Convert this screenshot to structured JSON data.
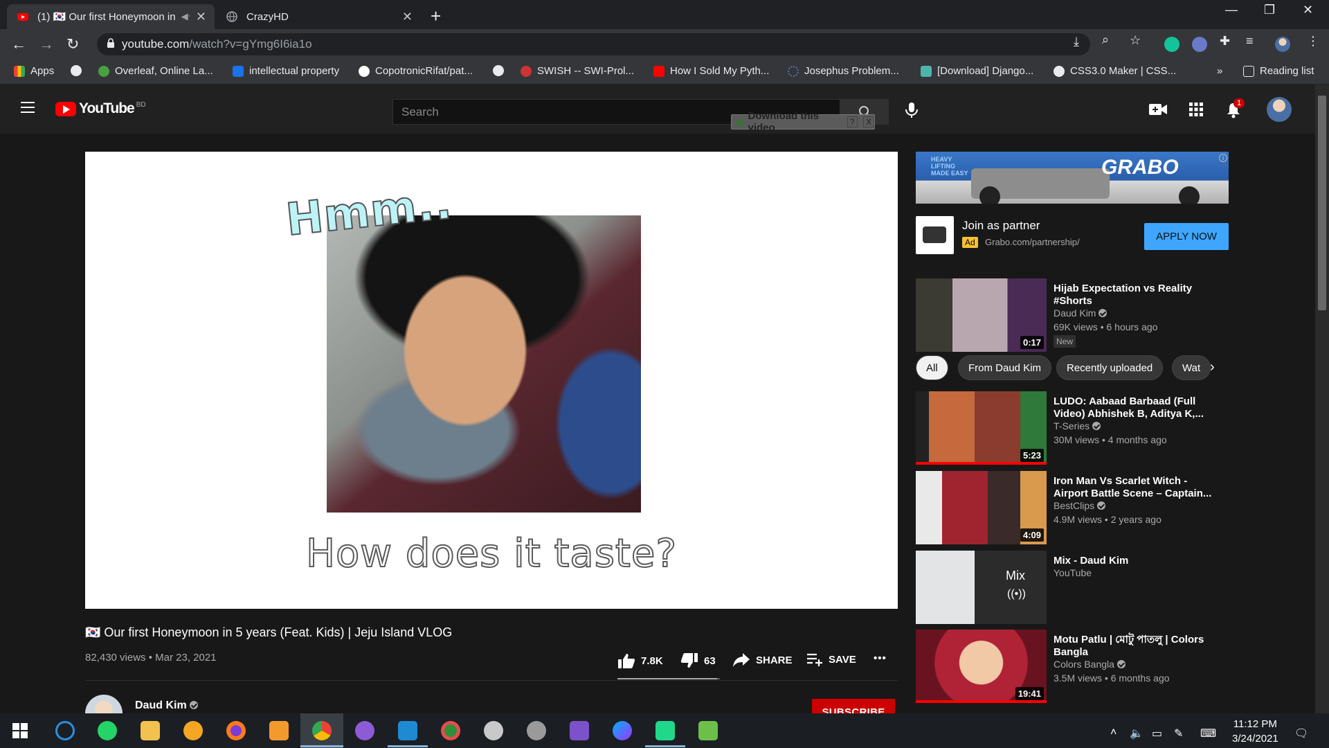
{
  "browser": {
    "tabs": [
      {
        "title": "(1) 🇰🇷 Our first Honeymoon in",
        "close": "✕"
      },
      {
        "title": "CrazyHD",
        "close": "✕"
      }
    ],
    "new_tab": "+",
    "url_host": "youtube.com",
    "url_path": "/watch?v=gYmg6I6ia1o",
    "bookmarks": [
      {
        "label": "Apps",
        "color": "#ea4335"
      },
      {
        "label": "",
        "color": "#e8eaed"
      },
      {
        "label": "Overleaf, Online La...",
        "color": "#47a141"
      },
      {
        "label": "intellectual property",
        "color": "#1a73e8"
      },
      {
        "label": "CopotronicRifat/pat...",
        "color": "#ffffff"
      },
      {
        "label": "",
        "color": "#e8eaed"
      },
      {
        "label": "SWISH -- SWI-Prol...",
        "color": "#cc3333"
      },
      {
        "label": "How I Sold My Pyth...",
        "color": "#ff0000"
      },
      {
        "label": "Josephus Problem...",
        "color": "#5c6bc0"
      },
      {
        "label": "[Download] Django...",
        "color": "#4db6ac"
      },
      {
        "label": "CSS3.0 Maker | CSS...",
        "color": "#e8eaed"
      }
    ],
    "bookmarks_more": "»",
    "reading_list": "Reading list"
  },
  "masthead": {
    "logo": "YouTube",
    "country": "BD",
    "search_placeholder": "Search",
    "download_button": "Download this video",
    "download_help": "?",
    "download_close": "X",
    "notification_count": "1"
  },
  "player": {
    "overlay_top": "Hmm..",
    "overlay_caption": "How does it taste?"
  },
  "video": {
    "title": "🇰🇷 Our first Honeymoon in 5 years (Feat. Kids) | Jeju Island VLOG",
    "views_date": "82,430 views • Mar 23, 2021",
    "likes": "7.8K",
    "dislikes": "63",
    "like_ratio": 0.97,
    "share": "SHARE",
    "save": "SAVE",
    "more": "•••",
    "channel": "Daud Kim",
    "subscribe": "SUBSCRIBE"
  },
  "ad": {
    "banner_brand": "GRABO",
    "banner_tag": "HEAVY LIFTING MADE EASY",
    "title": "Join as partner",
    "badge": "Ad",
    "url": "Grabo.com/partnership/",
    "cta": "APPLY NOW"
  },
  "chips": [
    "All",
    "From Daud Kim",
    "Recently uploaded",
    "Wat"
  ],
  "recommendations": [
    {
      "title": "Hijab Expectation vs Reality #Shorts",
      "channel": "Daud Kim",
      "verified": true,
      "views": "69K views • 6 hours ago",
      "duration": "0:17",
      "badge": "New"
    },
    {
      "title": "LUDO: Aabaad Barbaad (Full Video) Abhishek B, Aditya K,...",
      "channel": "T-Series",
      "verified": true,
      "views": "30M views • 4 months ago",
      "duration": "5:23",
      "badge": ""
    },
    {
      "title": "Iron Man Vs Scarlet Witch - Airport Battle Scene – Captain...",
      "channel": "BestClips",
      "verified": true,
      "views": "4.9M views • 2 years ago",
      "duration": "4:09",
      "badge": ""
    },
    {
      "title": "Mix - Daud Kim",
      "channel": "YouTube",
      "verified": false,
      "views": "",
      "duration": "",
      "badge": "",
      "mix_label": "Mix"
    },
    {
      "title": "Motu Patlu | মোটু পাতলু | Colors Bangla",
      "channel": "Colors Bangla",
      "verified": true,
      "views": "3.5M views • 6 months ago",
      "duration": "19:41",
      "badge": ""
    }
  ],
  "taskbar": {
    "time": "11:12 PM",
    "date": "3/24/2021"
  }
}
